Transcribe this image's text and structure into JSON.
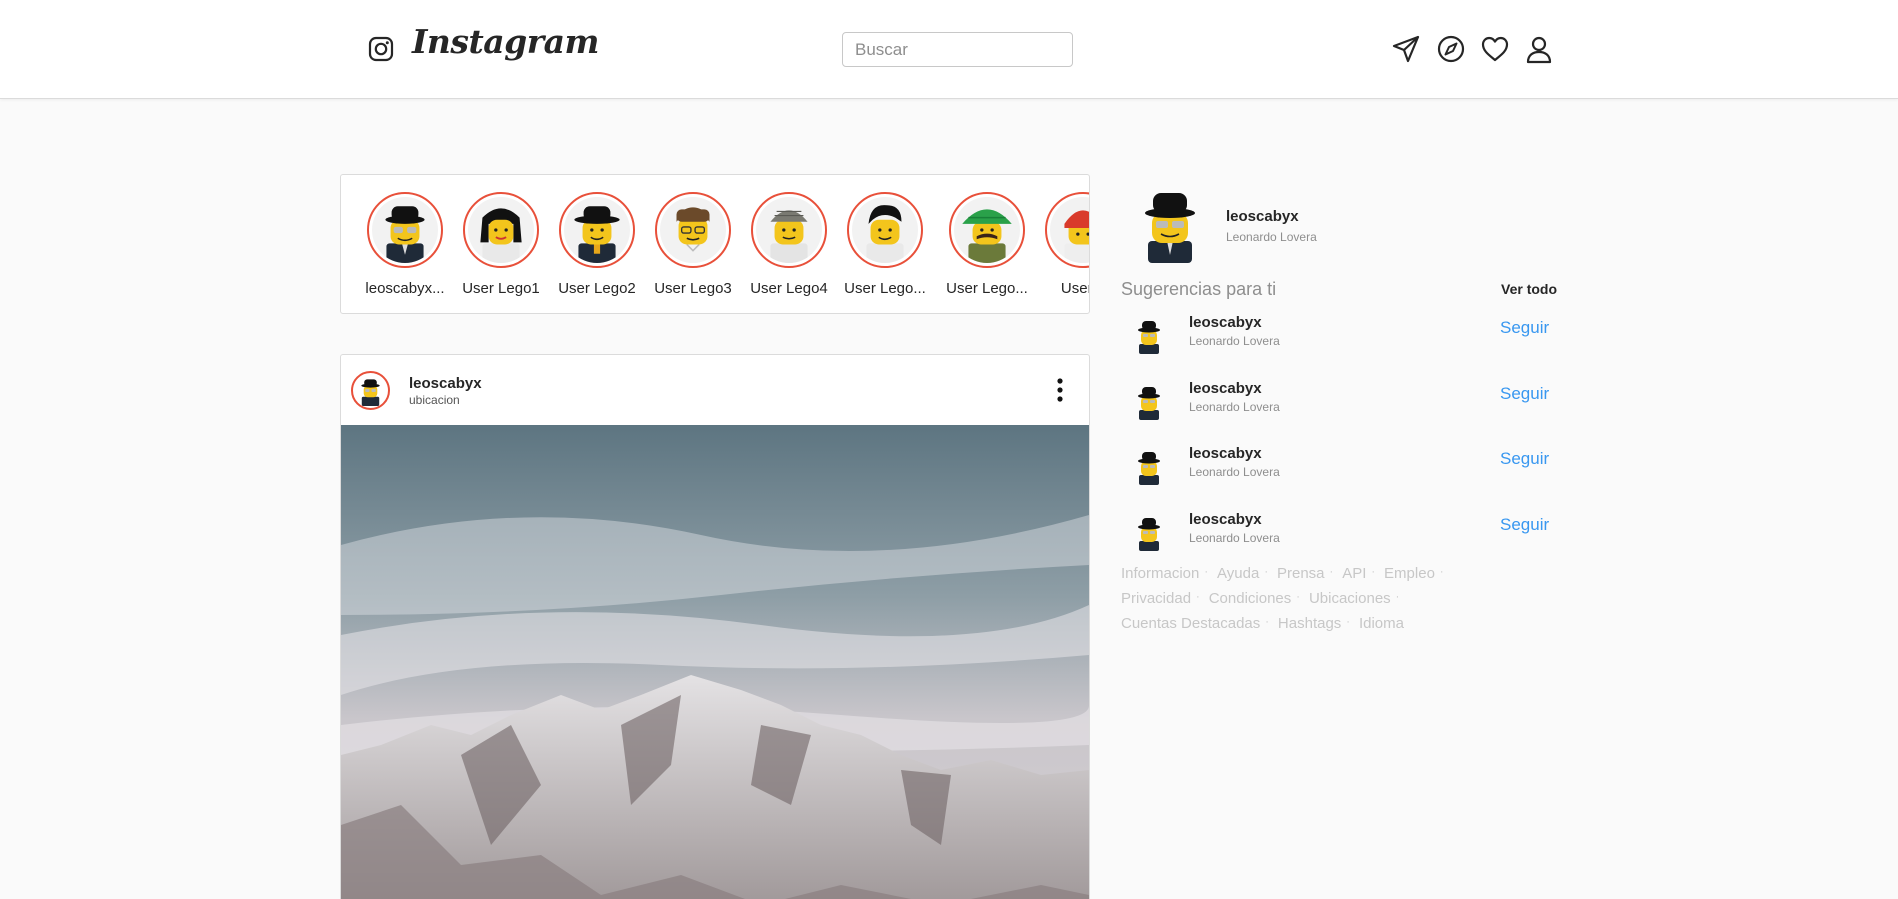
{
  "header": {
    "brand": "Instagram",
    "search_placeholder": "Buscar",
    "icons": [
      "instagram-glyph-icon",
      "paper-plane-icon",
      "compass-icon",
      "heart-icon",
      "user-icon"
    ]
  },
  "stories": [
    {
      "label": "leoscabyx...",
      "hat": "bowler"
    },
    {
      "label": "User Lego1",
      "hat": "hair-long"
    },
    {
      "label": "User Lego2",
      "hat": "bowler"
    },
    {
      "label": "User Lego3",
      "hat": "hair-brown"
    },
    {
      "label": "User Lego4",
      "hat": "cap-gray"
    },
    {
      "label": "User Lego...",
      "hat": "hair-black"
    },
    {
      "label": "User Lego...",
      "hat": "green-hat"
    },
    {
      "label": "User L",
      "hat": "red-helmet"
    }
  ],
  "post": {
    "username": "leoscabyx",
    "location": "ubicacion"
  },
  "profile": {
    "username": "leoscabyx",
    "full_name": "Leonardo Lovera"
  },
  "suggestions": {
    "title": "Sugerencias para ti",
    "see_all": "Ver todo",
    "items": [
      {
        "username": "leoscabyx",
        "full_name": "Leonardo Lovera",
        "action": "Seguir"
      },
      {
        "username": "leoscabyx",
        "full_name": "Leonardo Lovera",
        "action": "Seguir"
      },
      {
        "username": "leoscabyx",
        "full_name": "Leonardo Lovera",
        "action": "Seguir"
      },
      {
        "username": "leoscabyx",
        "full_name": "Leonardo Lovera",
        "action": "Seguir"
      }
    ]
  },
  "footer": {
    "lines": [
      [
        "Informacion",
        "Ayuda",
        "Prensa",
        "API",
        "Empleo"
      ],
      [
        "Privacidad",
        "Condiciones",
        "Ubicaciones"
      ],
      [
        "Cuentas Destacadas",
        "Hashtags",
        "Idioma"
      ]
    ]
  },
  "colors": {
    "accent_ring": "#e8503a",
    "link_blue": "#3897f0",
    "muted": "#8e8e8e",
    "footer": "#c7c7c7"
  }
}
